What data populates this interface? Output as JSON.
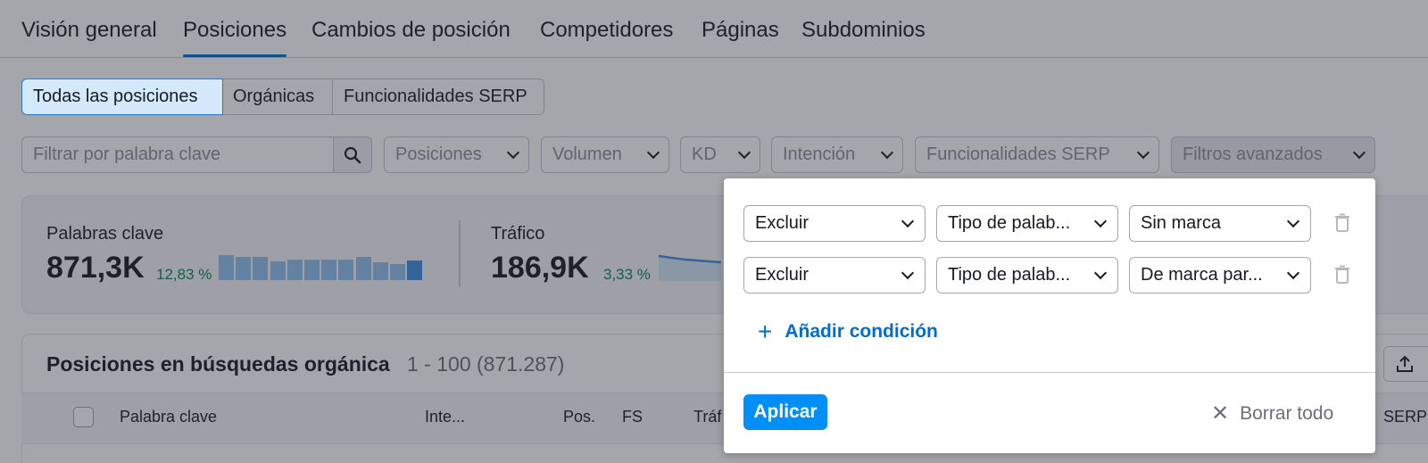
{
  "tabs": [
    {
      "label": "Visión general",
      "active": false
    },
    {
      "label": "Posiciones",
      "active": true
    },
    {
      "label": "Cambios de posición",
      "active": false
    },
    {
      "label": "Competidores",
      "active": false
    },
    {
      "label": "Páginas",
      "active": false
    },
    {
      "label": "Subdominios",
      "active": false
    }
  ],
  "segments": [
    {
      "label": "Todas las posiciones",
      "active": true
    },
    {
      "label": "Orgánicas",
      "active": false
    },
    {
      "label": "Funcionalidades SERP",
      "active": false
    }
  ],
  "filters": {
    "search_placeholder": "Filtrar por palabra clave",
    "dropdowns": [
      "Posiciones",
      "Volumen",
      "KD",
      "Intención",
      "Funcionalidades SERP",
      "Filtros avanzados"
    ]
  },
  "metrics": {
    "keywords": {
      "label": "Palabras clave",
      "value": "871,3K",
      "delta": "12,83 %"
    },
    "traffic": {
      "label": "Tráfico",
      "value": "186,9K",
      "delta": "3,33 %"
    },
    "keyword_trend": [
      0.95,
      0.9,
      0.88,
      0.72,
      0.78,
      0.8,
      0.78,
      0.8,
      0.88,
      0.68,
      0.62,
      0.75
    ]
  },
  "table": {
    "title": "Posiciones en búsquedas orgánica",
    "range": "1 - 100 (871.287)",
    "columns": [
      "Palabra clave",
      "Inte...",
      "Pos.",
      "FS",
      "Tráf",
      "SERP"
    ]
  },
  "advanced_filters": {
    "conditions": [
      {
        "mode": "Excluir",
        "field": "Tipo de palab...",
        "value": "Sin marca"
      },
      {
        "mode": "Excluir",
        "field": "Tipo de palab...",
        "value": "De marca par..."
      }
    ],
    "add_label": "Añadir condición",
    "apply_label": "Aplicar",
    "clear_label": "Borrar todo"
  },
  "colors": {
    "accent": "#006dca",
    "apply": "#008ff8",
    "positive": "#008852"
  }
}
